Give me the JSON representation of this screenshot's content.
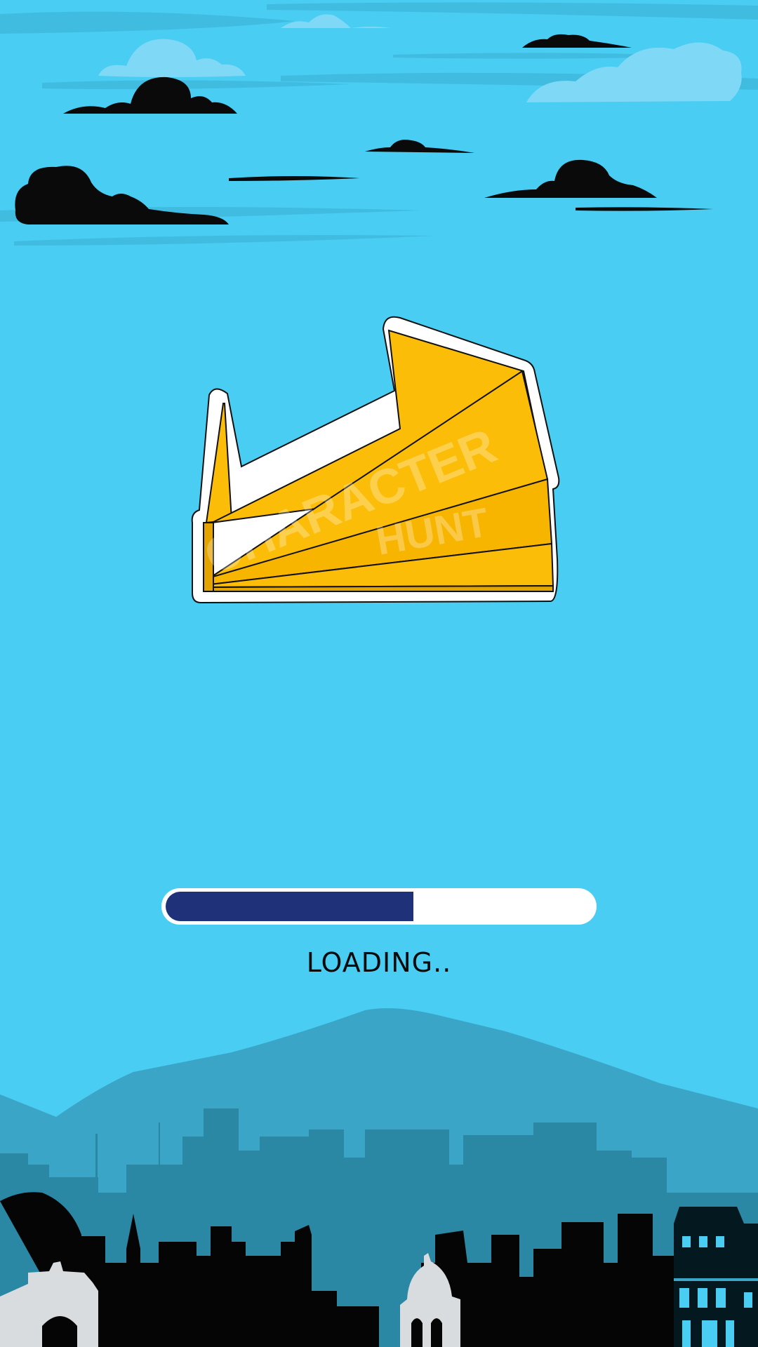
{
  "game": {
    "logo": {
      "line1": "CHARACTER",
      "line2": "HUNT"
    },
    "loading": {
      "label": "LOADING..",
      "progress": 0.58
    }
  },
  "colors": {
    "sky": "#49cdf3",
    "logo_yellow": "#fbbd08",
    "progress_fill": "#1f3178",
    "progress_track": "#ffffff",
    "mountain": "#3aa5c7",
    "skyline_far": "#2b88a5",
    "skyline_near": "#000000"
  }
}
